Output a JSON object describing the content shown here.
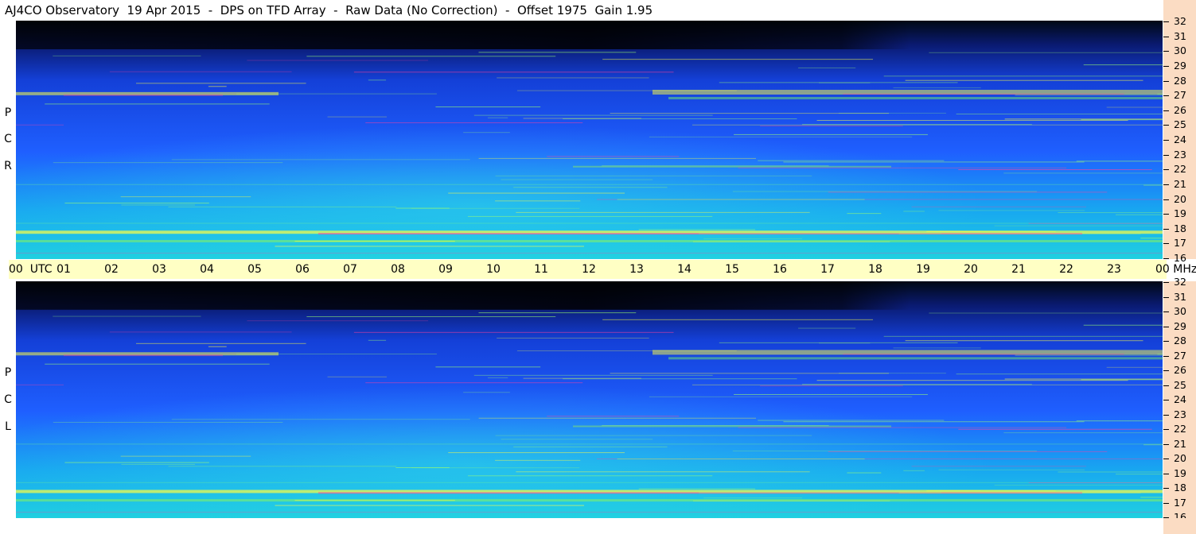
{
  "title": "AJ4CO Observatory  19 Apr 2015  -  DPS on TFD Array  -  Raw Data (No Correction)  -  Offset 1975  Gain 1.95",
  "panels": {
    "rcp": {
      "label_letters": [
        "P",
        "C",
        "R"
      ]
    },
    "lcp": {
      "label_letters": [
        "P",
        "C",
        "L"
      ]
    }
  },
  "time_axis": {
    "labels": [
      "00  UTC",
      "01",
      "02",
      "03",
      "04",
      "05",
      "06",
      "07",
      "08",
      "09",
      "10",
      "11",
      "12",
      "13",
      "14",
      "15",
      "16",
      "17",
      "18",
      "19",
      "20",
      "21",
      "22",
      "23",
      "00 MHz"
    ]
  },
  "freq_axis": {
    "ticks": [
      "32",
      "31",
      "30",
      "29",
      "28",
      "27",
      "26",
      "25",
      "24",
      "23",
      "22",
      "21",
      "20",
      "19",
      "18",
      "17",
      "16"
    ]
  },
  "colors": {
    "background": "#ffffff",
    "time_axis_bg": "#ffffc4",
    "freq_axis_bg": "#fbdcc3",
    "spectrogram_low": "#000814",
    "spectrogram_mid": "#1f5fff",
    "spectrogram_high": "#20d0e0",
    "interference": "#ffff40",
    "hot": "#ff40a0"
  },
  "chart_data": [
    {
      "type": "heatmap",
      "polarization": "RCP",
      "x_unit": "UTC hour",
      "y_unit": "MHz",
      "xlim": [
        0,
        24
      ],
      "ylim": [
        16,
        32
      ],
      "notes": "Dynamic spectrum; dark (low power) above ~29.5 MHz, brighter cyan/green at low frequencies, strong bands near 17.7 and 27 MHz"
    },
    {
      "type": "heatmap",
      "polarization": "LCP",
      "x_unit": "UTC hour",
      "y_unit": "MHz",
      "xlim": [
        0,
        24
      ],
      "ylim": [
        16,
        32
      ]
    }
  ]
}
